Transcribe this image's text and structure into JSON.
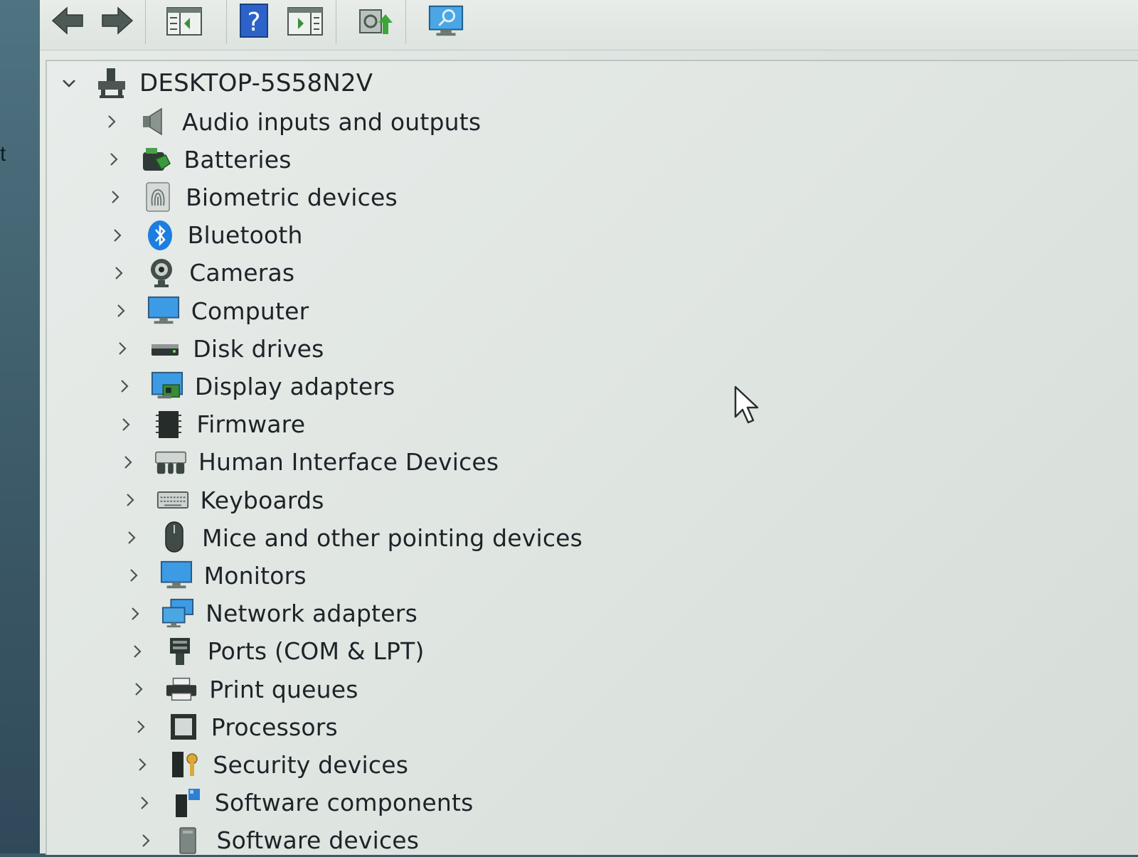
{
  "desktop": {
    "edge_text": "t"
  },
  "toolbar": {
    "buttons": [
      {
        "name": "back-arrow-icon"
      },
      {
        "name": "forward-arrow-icon"
      },
      {
        "name": "show-hide-console-tree-icon"
      },
      {
        "name": "help-icon"
      },
      {
        "name": "show-action-pane-icon"
      },
      {
        "name": "update-driver-icon"
      },
      {
        "name": "scan-hardware-changes-icon"
      }
    ]
  },
  "tree": {
    "root": {
      "label": "DESKTOP-5S58N2V",
      "icon": "computer-tower-icon",
      "expanded": true
    },
    "items": [
      {
        "label": "Audio inputs and outputs",
        "icon": "speaker-icon"
      },
      {
        "label": "Batteries",
        "icon": "battery-icon"
      },
      {
        "label": "Biometric devices",
        "icon": "fingerprint-icon"
      },
      {
        "label": "Bluetooth",
        "icon": "bluetooth-icon"
      },
      {
        "label": "Cameras",
        "icon": "webcam-icon"
      },
      {
        "label": "Computer",
        "icon": "monitor-icon"
      },
      {
        "label": "Disk drives",
        "icon": "disk-drive-icon"
      },
      {
        "label": "Display adapters",
        "icon": "display-adapter-icon"
      },
      {
        "label": "Firmware",
        "icon": "chip-icon"
      },
      {
        "label": "Human Interface Devices",
        "icon": "hid-icon"
      },
      {
        "label": "Keyboards",
        "icon": "keyboard-icon"
      },
      {
        "label": "Mice and other pointing devices",
        "icon": "mouse-icon"
      },
      {
        "label": "Monitors",
        "icon": "monitor-icon"
      },
      {
        "label": "Network adapters",
        "icon": "network-icon"
      },
      {
        "label": "Ports (COM & LPT)",
        "icon": "port-icon"
      },
      {
        "label": "Print queues",
        "icon": "printer-icon"
      },
      {
        "label": "Processors",
        "icon": "processor-icon"
      },
      {
        "label": "Security devices",
        "icon": "security-key-icon"
      },
      {
        "label": "Software components",
        "icon": "software-component-icon"
      },
      {
        "label": "Software devices",
        "icon": "software-device-icon"
      }
    ]
  },
  "colors": {
    "accent_blue": "#2e7fd1",
    "bluetooth_blue": "#1c7ee0",
    "text": "#1d2428"
  }
}
